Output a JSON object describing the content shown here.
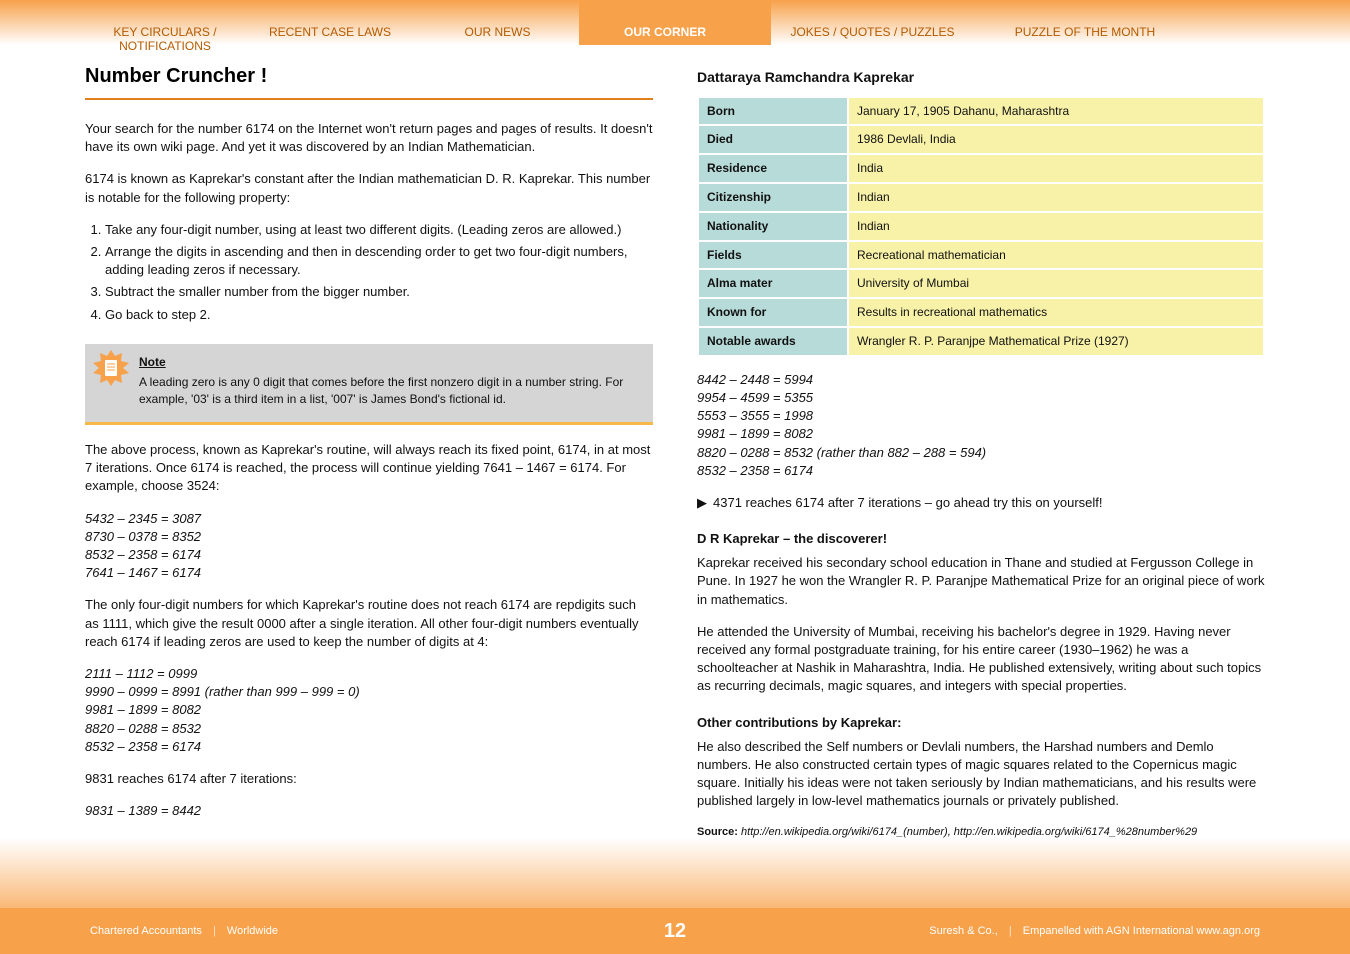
{
  "tabs": {
    "t0": "KEY CIRCULARS / NOTIFICATIONS",
    "t1": "RECENT CASE LAWS",
    "t2": "OUR NEWS",
    "t3": "OUR CORNER",
    "t4": "JOKES / QUOTES / PUZZLES",
    "t5": "PUZZLE OF THE MONTH"
  },
  "left": {
    "title": "Number Cruncher !",
    "p1": "Your search for the number 6174 on the Internet won't return pages and pages of results. It doesn't have its own wiki page. And yet it was discovered by an Indian Mathematician.",
    "p2": "6174 is known as Kaprekar's constant after the Indian mathematician D. R. Kaprekar. This number is notable for the following property:",
    "li1": "Take any four-digit number, using at least two different digits. (Leading zeros are allowed.)",
    "li2": "Arrange the digits in ascending and then in descending order to get two four-digit numbers, adding leading zeros if necessary.",
    "li3": "Subtract the smaller number from the bigger number.",
    "li4": "Go back to step 2.",
    "note_h": "Note",
    "note": "A leading zero is any 0 digit that comes before the first nonzero digit in a number string. For example,  '03' is a third item in a list, '007' is James Bond's fictional id.",
    "p3": "The above process, known as Kaprekar's routine, will always reach its fixed point, 6174, in at most 7 iterations. Once 6174 is reached, the process will continue yielding 7641 – 1467 = 6174. For example, choose 3524:",
    "eq1": "5432 – 2345 = 3087",
    "eq2": "8730 – 0378 = 8352",
    "eq3": "8532 – 2358 = 6174",
    "eq4": "7641 – 1467 = 6174",
    "p4": "The only four-digit numbers for which Kaprekar's routine does not reach 6174 are repdigits such as 1111, which give the result 0000 after a single iteration. All other four-digit numbers eventually reach 6174 if leading zeros are used to keep the number of digits at 4:",
    "eq5": "2111 – 1112 = 0999",
    "eq6": "9990 – 0999 = 8991 (rather than 999 – 999 = 0)",
    "eq7": "9981 – 1899 = 8082",
    "eq8": "8820 – 0288 = 8532",
    "eq9": "8532 – 2358 = 6174",
    "eq10": "9831 reaches 6174 after 7 iterations:",
    "eq11": "9831 – 1389 = 8442"
  },
  "right": {
    "h0": "Source:",
    "htable": "Dattaraya Ramchandra Kaprekar",
    "rows": [
      {
        "k": "Born",
        "v": "January 17, 1905 Dahanu, Maharashtra"
      },
      {
        "k": "Died",
        "v": "1986 Devlali, India"
      },
      {
        "k": "Residence",
        "v": "India"
      },
      {
        "k": "Citizenship",
        "v": "Indian"
      },
      {
        "k": "Nationality",
        "v": "Indian"
      },
      {
        "k": "Fields",
        "v": "Recreational mathematician"
      },
      {
        "k": "Alma mater",
        "v": "University of Mumbai"
      },
      {
        "k": "Known for",
        "v": "Results in recreational mathematics"
      },
      {
        "k": "Notable awards",
        "v": "Wrangler R. P. Paranjpe Mathematical Prize (1927)"
      }
    ],
    "eq12": "8442 – 2448 = 5994",
    "eq13": "9954 – 4599 = 5355",
    "eq14": "5553 – 3555 = 1998",
    "eq15": "9981 – 1899 = 8082",
    "eq16": "8820 – 0288 = 8532 (rather than 882 – 288 = 594)",
    "eq17": "8532 – 2358 = 6174",
    "p5": "4371 reaches 6174 after 7 iterations – go ahead try this on yourself!",
    "sub1": "D R Kaprekar – the discoverer!",
    "p6": "Kaprekar received his secondary school education in Thane and studied at Fergusson College in Pune. In 1927 he won the Wrangler R. P. Paranjpe Mathematical Prize for an original piece of work in mathematics.",
    "p7": "He attended the University of Mumbai, receiving his bachelor's degree in 1929. Having never received any formal postgraduate training, for his entire career (1930–1962) he was a schoolteacher at Nashik in Maharashtra, India. He published extensively, writing about such topics as recurring decimals, magic squares, and integers with special properties.",
    "sub2": "Other contributions by Kaprekar:",
    "p8": "He also described the Self numbers or Devlali numbers, the Harshad numbers and Demlo numbers. He also constructed certain types of magic squares related to the Copernicus magic square. Initially his ideas were not taken seriously by Indian mathematicians, and his results were published largely in low-level mathematics journals or privately published.",
    "src": "http://en.wikipedia.org/wiki/6174_(number), http://en.wikipedia.org/wiki/6174_%28number%29",
    "src_label": "Source:"
  },
  "footer": {
    "left1": "Chartered Accountants",
    "left2": "Worldwide",
    "page": "12",
    "right1": "Suresh & Co.,",
    "right2": "Empanelled with AGN International www.agn.org"
  }
}
